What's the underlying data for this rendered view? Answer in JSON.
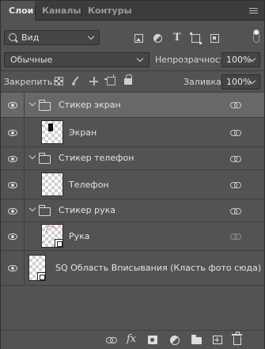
{
  "tabs": [
    {
      "label": "Слои",
      "active": true
    },
    {
      "label": "Каналы",
      "active": false
    },
    {
      "label": "Контуры",
      "active": false
    }
  ],
  "filter": {
    "kind_value": "Вид",
    "icons": [
      "image-filter-icon",
      "adjustment-filter-icon",
      "type-filter-icon",
      "shape-filter-icon",
      "smart-object-filter-icon"
    ]
  },
  "blend_mode": {
    "value": "Обычные"
  },
  "opacity": {
    "label": "Непрозрачность:",
    "value": "100%"
  },
  "lock": {
    "label": "Закрепить:",
    "icons": [
      "lock-transparent-icon",
      "lock-image-icon",
      "lock-position-icon",
      "lock-artboard-icon",
      "lock-all-icon"
    ]
  },
  "fill": {
    "label": "Заливка:",
    "value": "100%"
  },
  "layers": [
    {
      "type": "group",
      "name": "Стикер экран",
      "selected": true,
      "visible": true,
      "expanded": true,
      "linked": true
    },
    {
      "type": "layer",
      "name": "Экран",
      "selected": false,
      "visible": true,
      "linked": true,
      "thumbnail": "phone-screen"
    },
    {
      "type": "group",
      "name": "Стикер телефон",
      "selected": false,
      "visible": true,
      "expanded": true,
      "linked": true
    },
    {
      "type": "layer",
      "name": "Телефон",
      "selected": false,
      "visible": true,
      "linked": true,
      "thumbnail": "transparent"
    },
    {
      "type": "group",
      "name": "Стикер рука",
      "selected": false,
      "visible": true,
      "expanded": true,
      "linked": true
    },
    {
      "type": "layer",
      "name": "Рука",
      "selected": false,
      "visible": true,
      "linked": false,
      "thumbnail": "smart-object"
    },
    {
      "type": "layer",
      "name": "SQ Область Вписывания (Класть фото сюда)",
      "selected": false,
      "visible": true,
      "linked": false,
      "thumbnail": "smart-object"
    }
  ],
  "bottom_toolbar": [
    "link-layers-icon",
    "fx-icon",
    "add-mask-icon",
    "new-adjustment-icon",
    "new-group-icon",
    "new-layer-icon",
    "delete-layer-icon"
  ],
  "colors": {
    "panel_bg": "#535353",
    "tabbar_bg": "#3c3c3c",
    "selected_row": "#686868",
    "field_bg": "#454545"
  }
}
